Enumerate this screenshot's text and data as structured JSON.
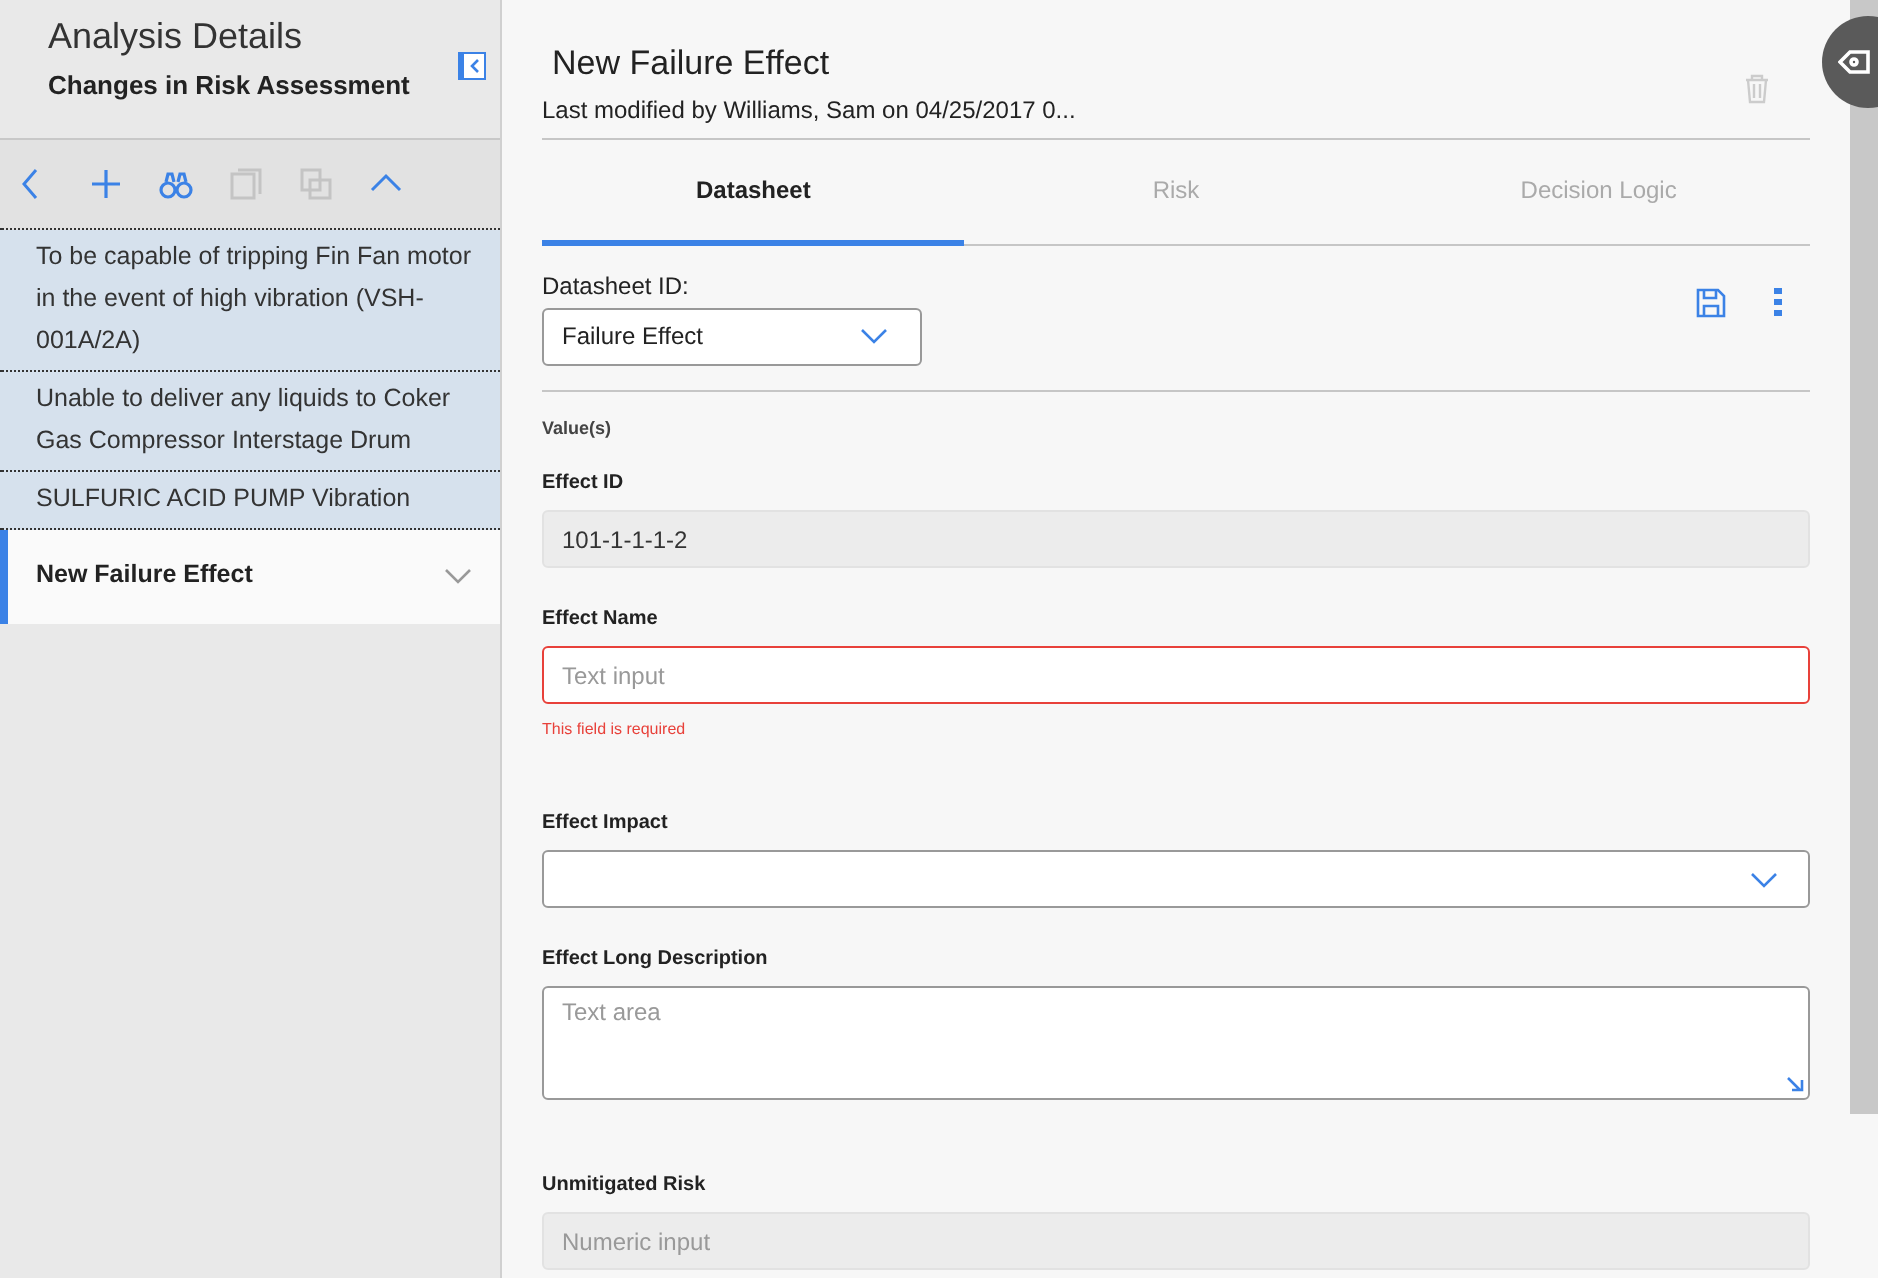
{
  "sidebar": {
    "title": "Analysis Details",
    "subtitle": "Changes in Risk Assessment",
    "toolbar": [
      {
        "kind": "back",
        "disabled": false
      },
      {
        "kind": "add",
        "disabled": false
      },
      {
        "kind": "find",
        "disabled": false
      },
      {
        "kind": "copy",
        "disabled": true
      },
      {
        "kind": "paste",
        "disabled": true
      },
      {
        "kind": "collapse",
        "disabled": false
      }
    ],
    "items": [
      {
        "label": "To be capable of tripping Fin Fan motor in the event of high vibration (VSH-001A/2A)",
        "selected": false
      },
      {
        "label": "Unable to deliver any liquids to Coker Gas Compressor Interstage Drum",
        "selected": false
      },
      {
        "label": "SULFURIC ACID PUMP Vibration",
        "selected": false
      },
      {
        "label": "New Failure Effect",
        "selected": true
      }
    ]
  },
  "record": {
    "title": "New Failure Effect",
    "modified": "Last modified by Williams, Sam on 04/25/2017 0..."
  },
  "tabs": [
    {
      "label": "Datasheet",
      "selected": true
    },
    {
      "label": "Risk",
      "selected": false
    },
    {
      "label": "Decision Logic",
      "selected": false
    }
  ],
  "datasheet": {
    "label": "Datasheet ID:",
    "value": "Failure Effect"
  },
  "section": "Value(s)",
  "fields": [
    {
      "kind": "text",
      "label": "Effect ID",
      "value": "101-1-1-1-2",
      "disabled": true
    },
    {
      "kind": "text",
      "label": "Effect Name",
      "placeholder": "Text input",
      "disabled": false,
      "error": "This field is required"
    },
    {
      "kind": "select",
      "label": "Effect Impact"
    },
    {
      "kind": "textarea",
      "label": "Effect Long Description",
      "placeholder": "Text area"
    },
    {
      "kind": "text",
      "label": "Unmitigated Risk",
      "placeholder": "Numeric input",
      "disabled": true
    }
  ]
}
